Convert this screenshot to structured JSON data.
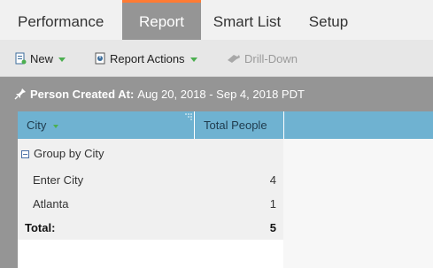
{
  "tabs": [
    {
      "label": "Performance"
    },
    {
      "label": "Report"
    },
    {
      "label": "Smart List"
    },
    {
      "label": "Setup"
    }
  ],
  "active_tab": "Report",
  "toolbar": {
    "new_label": "New",
    "report_actions_label": "Report Actions",
    "drill_down_label": "Drill-Down"
  },
  "filter": {
    "label": "Person Created At:",
    "value": "Aug 20, 2018 - Sep 4, 2018 PDT"
  },
  "grid": {
    "columns": [
      "City",
      "Total People"
    ],
    "group_label": "Group by City",
    "rows": [
      {
        "city": "Enter City",
        "total": "4"
      },
      {
        "city": "Atlanta",
        "total": "1"
      }
    ],
    "total_label": "Total:",
    "total_value": "5"
  },
  "colors": {
    "active_tab_accent": "#ff7b34",
    "header_blue": "#6fb2d1",
    "dropdown_caret": "#4caf50"
  }
}
